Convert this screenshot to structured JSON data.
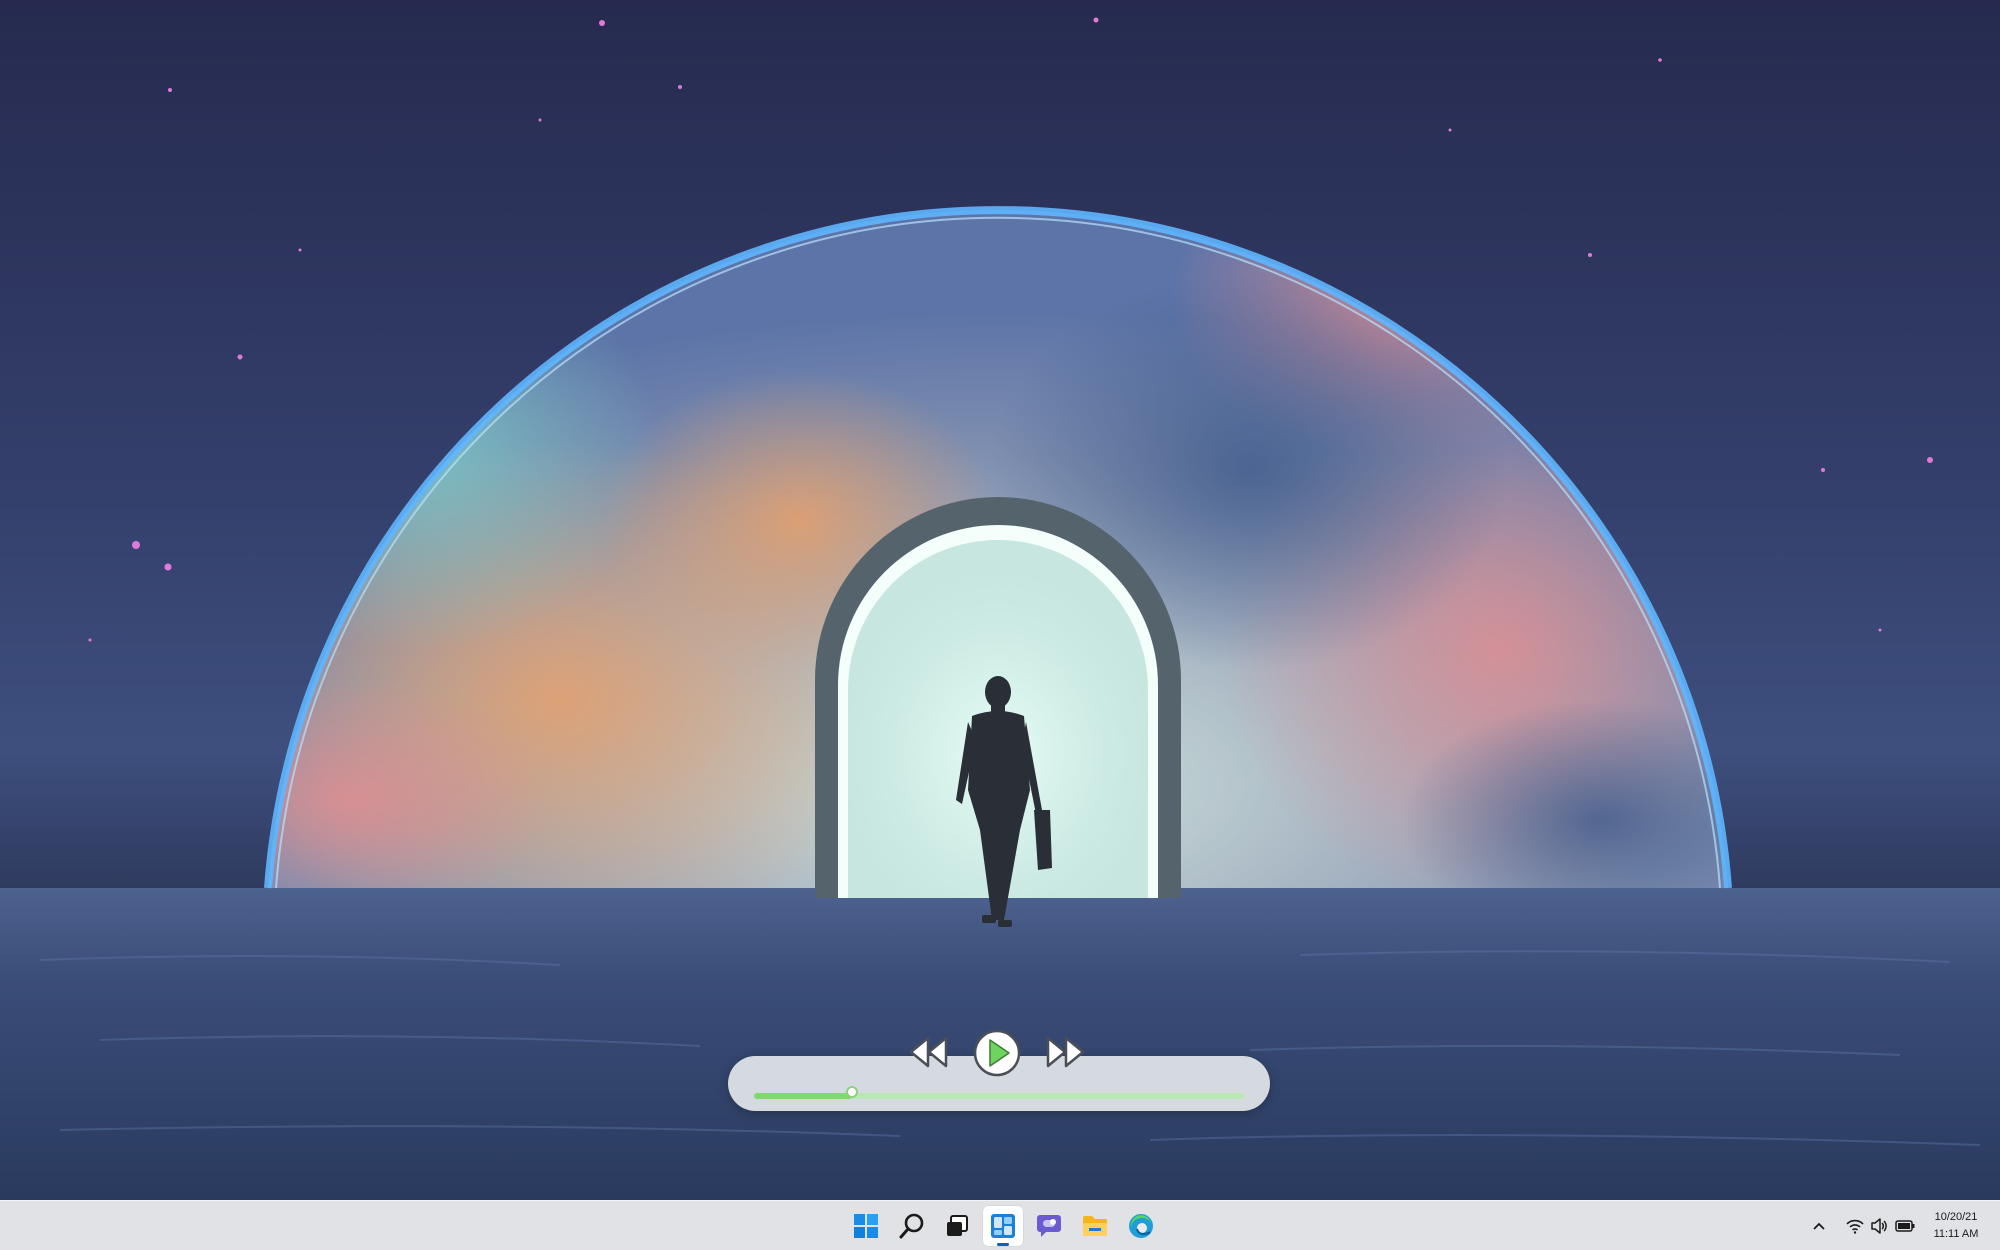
{
  "wallpaper": {
    "icon": "portal-dome-wallpaper"
  },
  "media_player": {
    "progress": 0.2,
    "controls": {
      "rewind_icon": "rewind-icon",
      "play_icon": "play-icon",
      "forward_icon": "fast-forward-icon"
    },
    "colors": {
      "play": "#6fd35f",
      "progress": "#7fd872"
    }
  },
  "taskbar": {
    "items": [
      {
        "name": "start",
        "icon": "windows-logo-icon"
      },
      {
        "name": "search",
        "icon": "search-icon"
      },
      {
        "name": "task-view",
        "icon": "task-view-icon"
      },
      {
        "name": "widgets",
        "icon": "widgets-icon",
        "active": true
      },
      {
        "name": "chat",
        "icon": "chat-icon"
      },
      {
        "name": "file-explorer",
        "icon": "folder-icon"
      },
      {
        "name": "edge",
        "icon": "edge-browser-icon"
      }
    ],
    "tray": {
      "icons": [
        "chevron-up-icon",
        "wifi-icon",
        "volume-icon",
        "battery-icon"
      ],
      "date": "10/20/21",
      "time": "11:11 AM"
    }
  }
}
